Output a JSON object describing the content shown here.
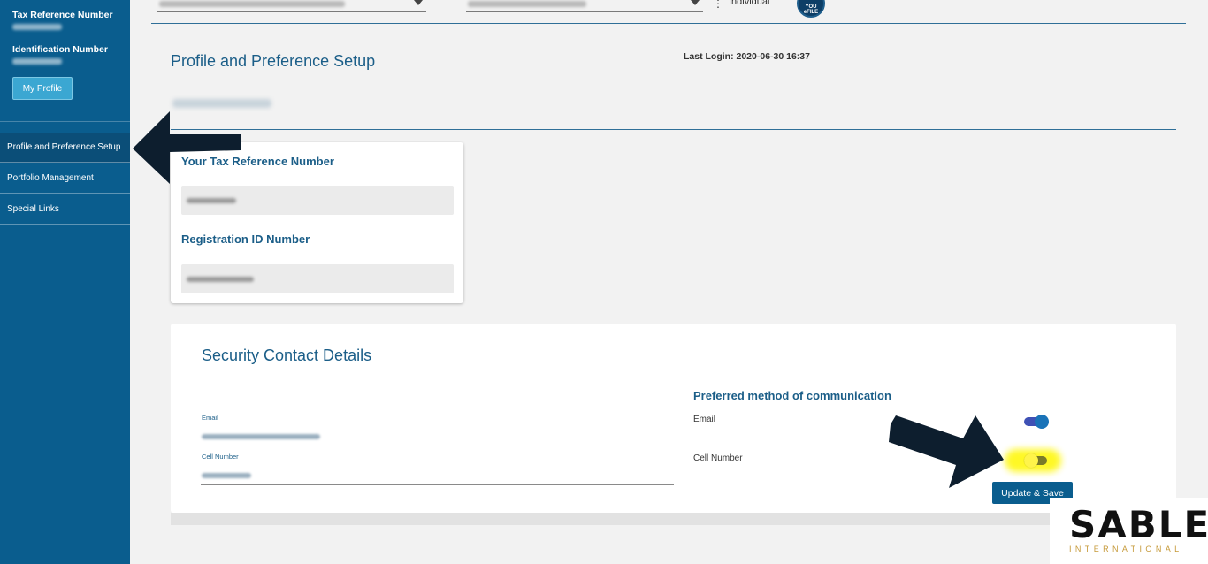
{
  "sidebar": {
    "tax_ref_label": "Tax Reference Number",
    "id_label": "Identification Number",
    "my_profile_button": "My Profile",
    "nav": [
      {
        "label": "Profile and Preference Setup",
        "active": true
      },
      {
        "label": "Portfolio Management",
        "active": false
      },
      {
        "label": "Special Links",
        "active": false
      }
    ]
  },
  "topbar": {
    "taxpayer_type": "Individual",
    "logo_text": "YOU eFILE",
    "kebab": "⋮"
  },
  "header": {
    "title": "Profile and Preference Setup",
    "last_login": "Last Login: 2020-06-30 16:37"
  },
  "identity_card": {
    "tax_ref_title": "Your Tax Reference Number",
    "reg_id_title": "Registration ID Number"
  },
  "security": {
    "title": "Security Contact Details",
    "email_label": "Email",
    "cell_label": "Cell Number",
    "pref_title": "Preferred method of communication",
    "pref_email_label": "Email",
    "pref_cell_label": "Cell Number",
    "pref_email_on": true,
    "pref_cell_on": false,
    "update_button": "Update & Save"
  },
  "watermark": {
    "brand": "SABLE",
    "sub": "INTERNATIONAL"
  },
  "colors": {
    "primary": "#0a5d8e",
    "accent_title": "#1b5e88",
    "toggle_on": "#1a73b8",
    "highlight": "#fff700",
    "arrow": "#0d1e2e"
  }
}
